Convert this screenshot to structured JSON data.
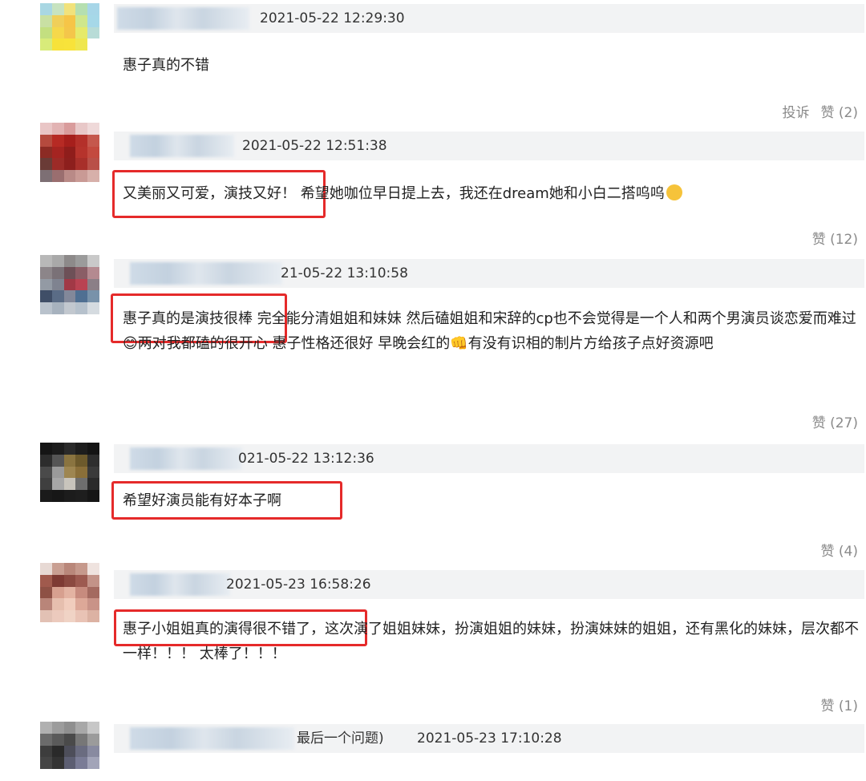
{
  "comments": [
    {
      "time": "2021-05-22 12:29:30",
      "text": "惠子真的不错",
      "report_label": "投诉",
      "like_label": "赞 (2)",
      "avatar_colors": [
        "#a9d7e3",
        "#c7e3c0",
        "#f1e27b",
        "#b5dfb0",
        "#a7d6e8",
        "#c9e0a3",
        "#f0cf59",
        "#f6c547",
        "#cfe78c",
        "#a6d8e8",
        "#c3df80",
        "#f5d84b",
        "#f4c64a",
        "#e6ea6a",
        "#b8dcd7",
        "#d8eb7a",
        "#f7e23a",
        "#f8e33a",
        "#efe750",
        "#ffffff",
        "#ffffff",
        "#ffffff",
        "#ffffff",
        "#ffffff",
        "#ffffff"
      ]
    },
    {
      "time": "2021-05-22 12:51:38",
      "text_highlight": "又美丽又可爱，演技又好！",
      "text_rest": "希望她咖位早日提上去，我还在dream她和小白二搭呜呜",
      "like_label": "赞 (12)",
      "avatar_colors": [
        "#e9c6c6",
        "#e2b3b3",
        "#d99c9c",
        "#e8c8c8",
        "#efd9d9",
        "#b54a3e",
        "#b62a24",
        "#a61f1c",
        "#b4302a",
        "#c5584d",
        "#8c2b24",
        "#a52421",
        "#8f1d1b",
        "#b6332c",
        "#c34a3f",
        "#6a3b36",
        "#9c2b27",
        "#8d1f1d",
        "#a82f2a",
        "#b95048",
        "#7d6f74",
        "#9a6e6f",
        "#b98a87",
        "#c99a95",
        "#d7b0aa"
      ]
    },
    {
      "time": "21-05-22 13:10:58",
      "text_highlight": "惠子真的是演技很棒",
      "text_rest": "完全能分清姐姐和妹妹 然后磕姐姐和宋辞的cp也不会觉得是一个人和两个男演员谈恋爱而难过😊两对我都磕的很开心 惠子性格还很好 早晚会红的👊有没有识相的制片方给孩子点好资源吧",
      "like_label": "赞 (27)",
      "avatar_colors": [
        "#b8b8b8",
        "#a9a9a9",
        "#8d8a8a",
        "#9b9b9b",
        "#c9c9c9",
        "#8c8589",
        "#7a7177",
        "#6d5057",
        "#8a5e66",
        "#b48a90",
        "#939aa4",
        "#7f8390",
        "#a13946",
        "#b94352",
        "#8b7f87",
        "#3f4e67",
        "#5a6c86",
        "#82889a",
        "#4f6f92",
        "#7892aa",
        "#b9c2cc",
        "#a7b2be",
        "#c2c8cf",
        "#b6c1cc",
        "#d5dbe0"
      ]
    },
    {
      "time": "021-05-22 13:12:36",
      "text_highlight": "希望好演员能有好本子啊",
      "like_label": "赞 (4)",
      "avatar_colors": [
        "#151515",
        "#1c1c1c",
        "#2a2a2a",
        "#1d1d1d",
        "#141414",
        "#2d2d2d",
        "#555555",
        "#8a7440",
        "#6d5a2c",
        "#2e2e2e",
        "#4a4a4a",
        "#9a9a9a",
        "#9e8651",
        "#8a6f39",
        "#3a3a3a",
        "#3f3f3f",
        "#a7a7a7",
        "#c8c4bc",
        "#6e6e6e",
        "#2a2a2a",
        "#1a1a1a",
        "#171717",
        "#1c1c1c",
        "#1e1e1e",
        "#161616"
      ]
    },
    {
      "time": "2021-05-23 16:58:26",
      "text_highlight": "惠子小姐姐真的演得很不错了，",
      "text_rest": "这次演了姐姐妹妹，扮演姐姐的妹妹，扮演妹妹的姐姐，还有黑化的妹妹，层次都不一样！！！ 太棒了！！！",
      "like_label": "赞 (1)",
      "avatar_colors": [
        "#e7d9d4",
        "#c99f92",
        "#b9877a",
        "#c6998c",
        "#efe3df",
        "#a05a4d",
        "#7e3a33",
        "#8b4940",
        "#9d5a50",
        "#c39388",
        "#8e5145",
        "#d7a08f",
        "#e3b3a2",
        "#c78b7e",
        "#a46a60",
        "#b98579",
        "#e6bfae",
        "#f1cdbd",
        "#dda898",
        "#c99388",
        "#e2c1b4",
        "#eccabd",
        "#f0d3c5",
        "#e9c3b5",
        "#dcb2a3"
      ]
    },
    {
      "time_prefix": "最后一个问题)",
      "time": "2021-05-23 17:10:28",
      "avatar_colors": [
        "#b0b0b0",
        "#9c9c9c",
        "#8f8f8f",
        "#a8a8a8",
        "#c7c7c7",
        "#6b6b6b",
        "#5a5a5a",
        "#4a4a4a",
        "#777777",
        "#9b9b9b",
        "#3d3d3d",
        "#2a2a2a",
        "#4d4e5a",
        "#6a6c80",
        "#888aa0",
        "#454545",
        "#333333",
        "#5c5e72",
        "#7a7c96",
        "#a2a4b8",
        "#ffffff",
        "#ffffff",
        "#ffffff",
        "#ffffff",
        "#ffffff"
      ]
    }
  ]
}
